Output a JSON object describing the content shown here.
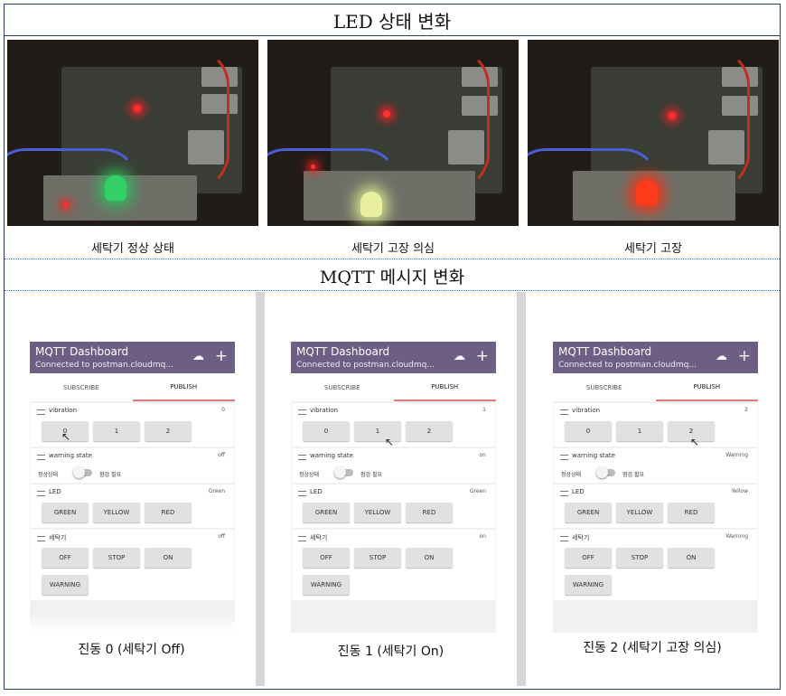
{
  "titles": {
    "led_section": "LED 상태 변화",
    "mqtt_section": "MQTT 메시지 변화"
  },
  "photos": [
    {
      "caption": "세탁기 정상 상태",
      "led_color": "#34d067"
    },
    {
      "caption": "세탁기 고장 의심",
      "led_color": "#e8f0a0"
    },
    {
      "caption": "세탁기 고장",
      "led_color": "#ff3a1a"
    }
  ],
  "app": {
    "title": "MQTT Dashboard",
    "subtitle": "Connected to postman.cloudmq...",
    "tab_subscribe": "SUBSCRIBE",
    "tab_publish": "PUBLISH",
    "vibration_label": "vibration",
    "warning_label": "warning state",
    "toggle_left": "정상상태",
    "toggle_right": "점검 필요",
    "led_label": "LED",
    "washer_label": "세탁기",
    "vib_buttons": [
      "0",
      "1",
      "2"
    ],
    "led_buttons": [
      "GREEN",
      "YELLOW",
      "RED"
    ],
    "washer_buttons": [
      "OFF",
      "STOP",
      "ON",
      "WARNING"
    ]
  },
  "screens": [
    {
      "caption": "진동 0 (세탁기 Off)",
      "vibration_value": "0",
      "warning_value": "off",
      "led_value": "Green",
      "washer_value": "off"
    },
    {
      "caption": "진동 1 (세탁기 On)",
      "vibration_value": "1",
      "warning_value": "on",
      "led_value": "Green",
      "washer_value": "on"
    },
    {
      "caption": "진동 2 (세탁기 고장 의심)",
      "vibration_value": "2",
      "warning_value": "Warning",
      "led_value": "Yellow",
      "washer_value": "Warning"
    }
  ]
}
